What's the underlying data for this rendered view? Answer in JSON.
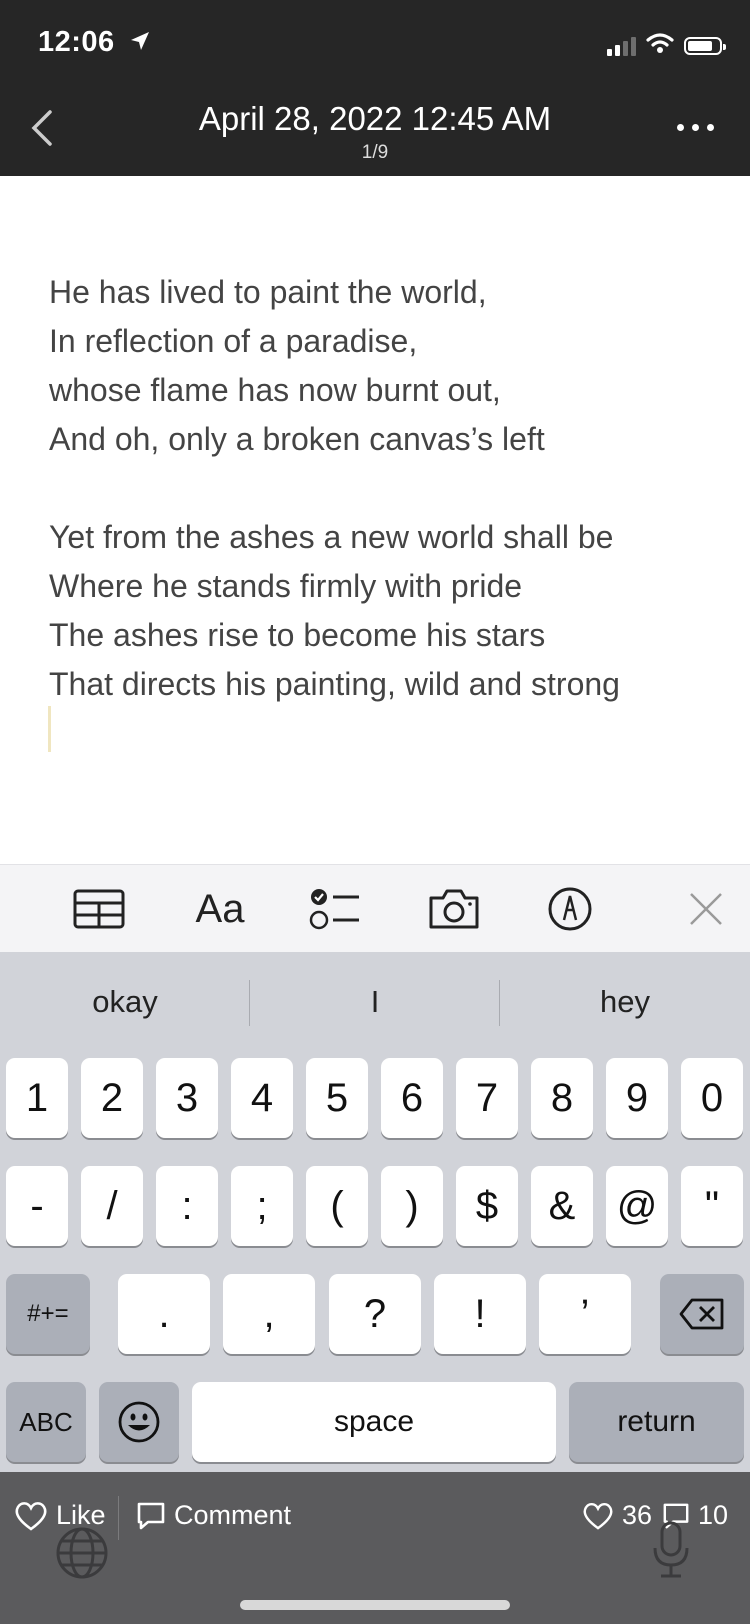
{
  "status": {
    "time": "12:06"
  },
  "header": {
    "title": "April 28, 2022 12:45 AM",
    "subtitle": "1/9"
  },
  "note": {
    "stanza1": [
      "He has lived to paint the world,",
      "In reflection of a paradise,",
      "whose flame has now burnt out,",
      "And oh, only a broken canvas’s left"
    ],
    "stanza2": [
      "Yet from the ashes a new world shall be",
      "Where he stands firmly with pride",
      "The ashes rise to become his stars",
      "That directs his painting, wild and strong"
    ]
  },
  "toolbar": {
    "format_label": "Aa"
  },
  "keyboard": {
    "suggestions": [
      "okay",
      "I",
      "hey"
    ],
    "row1": [
      "1",
      "2",
      "3",
      "4",
      "5",
      "6",
      "7",
      "8",
      "9",
      "0"
    ],
    "row2": [
      "-",
      "/",
      ":",
      ";",
      "(",
      ")",
      "$",
      "&",
      "@",
      "\""
    ],
    "row3": {
      "shift_label": "#+=",
      "keys": [
        ".",
        ",",
        "?",
        "!",
        "’"
      ]
    },
    "row4": {
      "abc_label": "ABC",
      "space_label": "space",
      "return_label": "return"
    }
  },
  "bottom_bar": {
    "like_label": "Like",
    "comment_label": "Comment",
    "likes_count": "36",
    "comments_count": "10"
  }
}
